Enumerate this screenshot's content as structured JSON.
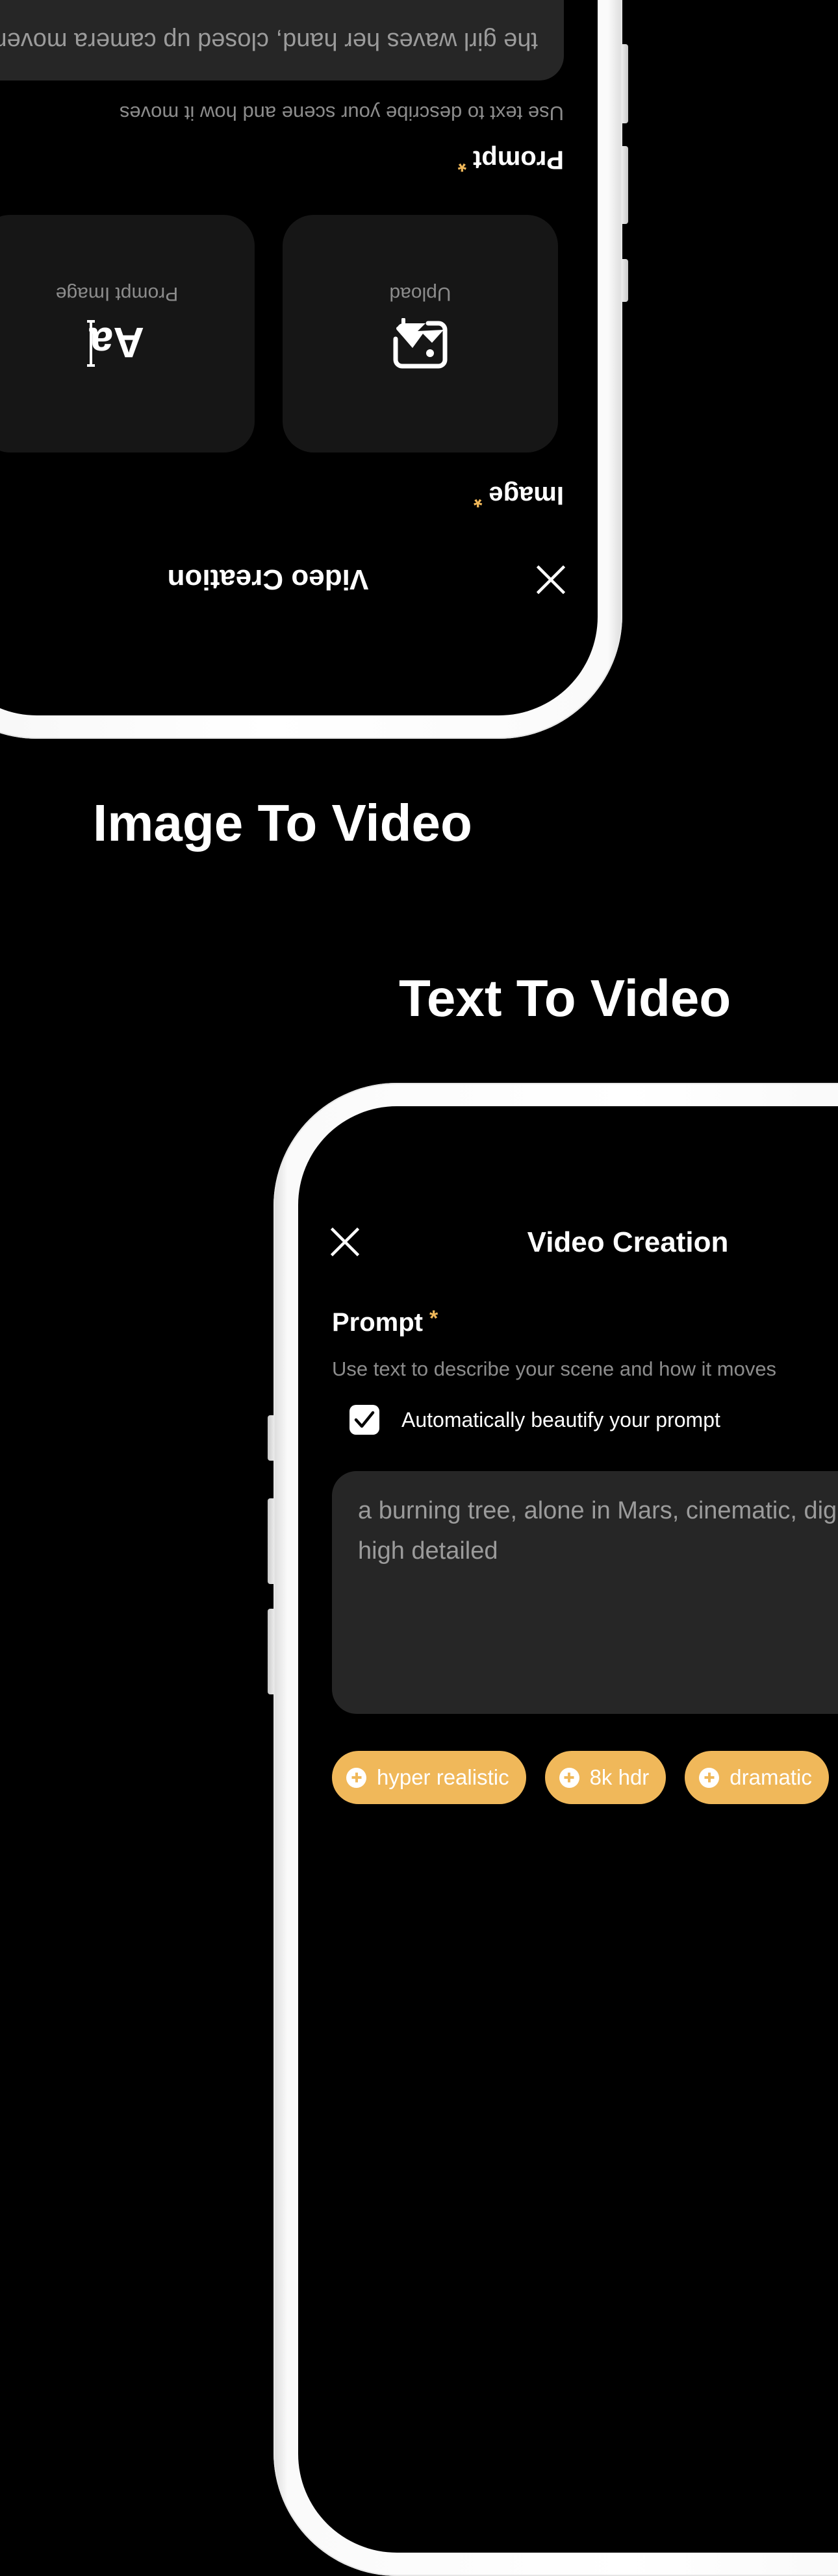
{
  "headings": {
    "image_to_video": "Image To Video",
    "text_to_video": "Text To Video"
  },
  "colors": {
    "accent": "#F0B85A",
    "background": "#000000",
    "field_bg": "#262626",
    "card_bg": "#161616",
    "muted_text": "#8c8c8c"
  },
  "image_to_video_screen": {
    "orientation": "rotated 180°",
    "title": "Video Creation",
    "close_icon": "close-icon",
    "image_section": {
      "label": "Image",
      "required_mark": "*",
      "options": [
        {
          "label": "Upload",
          "icon": "image-upload-icon"
        },
        {
          "label": "Prompt Image",
          "icon": "text-prompt-icon"
        }
      ]
    },
    "prompt_section": {
      "label": "Prompt",
      "required_mark": "*",
      "helper": "Use text to describe your scene and how it moves",
      "value": "the girl waves her hand, closed up camera movement"
    }
  },
  "text_to_video_screen": {
    "title": "Video Creation",
    "close_icon": "close-icon",
    "prompt_section": {
      "label": "Prompt",
      "required_mark": "*",
      "helper": "Use text to describe your scene and how it moves",
      "beautify_checkbox": {
        "label": "Automatically beautify your prompt",
        "checked": true
      },
      "value": "a burning tree, alone in Mars, cinematic, digital art, high detailed"
    },
    "chips": [
      {
        "label": "hyper realistic",
        "icon": "plus-circle-icon"
      },
      {
        "label": "8k hdr",
        "icon": "plus-circle-icon"
      },
      {
        "label": "dramatic",
        "icon": "plus-circle-icon"
      }
    ]
  }
}
